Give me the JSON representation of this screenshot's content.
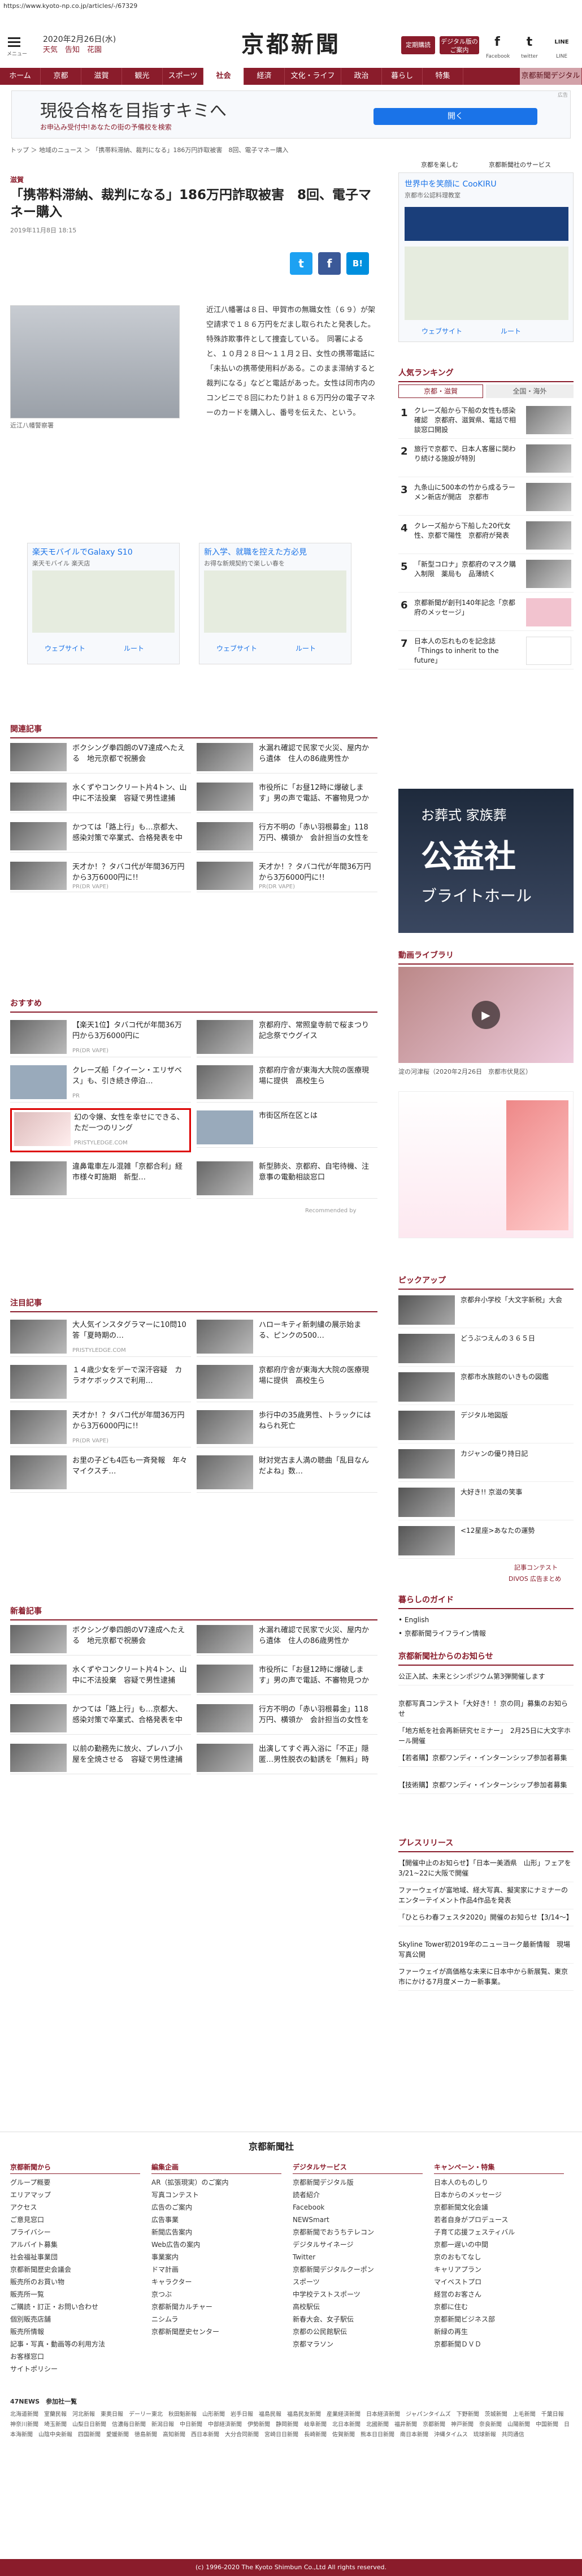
{
  "url": "https://www.kyoto-np.co.jp/articles/-/67329",
  "header": {
    "menu_label": "メニュー",
    "date": "2020年2月26日(水)",
    "weather": "天気　告知　花園",
    "logo": "京都新聞",
    "btn_signup": "定期購読",
    "btn_digital": "デジタル版のご案内",
    "social": [
      {
        "icon": "f",
        "label": "Facebook"
      },
      {
        "icon": "t",
        "label": "twitter"
      },
      {
        "icon": "LINE",
        "label": "LINE"
      }
    ]
  },
  "nav": [
    "ホーム",
    "京都",
    "滋賀",
    "観光",
    "スポーツ",
    "社会",
    "経済",
    "文化・ライフ",
    "政治",
    "暮らし",
    "特集",
    "京都新聞デジタル"
  ],
  "nav_active": 5,
  "ad_top": {
    "title": "現役合格を目指すキミへ",
    "sub": "お申込み受付中!あなたの街の予備校を検索",
    "btn": "開く",
    "label": "広告"
  },
  "breadcrumb": "トップ ＞ 地域のニュース ＞ 「携帯料滞納、裁判になる」186万円詐取被害　8回、電子マネー購入",
  "right_links": [
    "京都を楽しむ",
    "京都新聞社のサービス"
  ],
  "article": {
    "category": "滋賀",
    "title": "「携帯料滞納、裁判になる」186万円詐取被害　8回、電子マネー購入",
    "date": "2019年11月8日 18:15",
    "caption": "近江八幡警察署",
    "body": "近江八幡署は８日、甲賀市の無職女性（６９）が架空請求で１８６万円をだまし取られたと発表した。特殊詐欺事件として捜査している。　同署によると、１０月２８日～１１月２日、女性の携帯電話に「未払いの携帯使用料がある。このまま滞納すると裁判になる」などと電話があった。女性は同市内のコンビニで８回にわたり計１８６万円分の電子マネーのカードを購入し、番号を伝えた、という。",
    "share": [
      "t",
      "f",
      "B!"
    ]
  },
  "ad_mid": [
    {
      "title": "楽天モバイルでGalaxy S10",
      "sub": "楽天モバイル 楽天店",
      "btn_web": "ウェブサイト",
      "btn_route": "ルート"
    },
    {
      "title": "新入学、就職を控えた方必見",
      "sub": "お得な新規契約で楽しい春を",
      "btn_web": "ウェブサイト",
      "btn_route": "ルート"
    }
  ],
  "right_ad": {
    "title": "世界中を笑顔に CooKIRU",
    "sub": "京都市公認料理教室",
    "btn_web": "ウェブサイト",
    "btn_route": "ルート"
  },
  "ranking": {
    "title": "人気ランキング",
    "tabs": [
      "京都・滋賀",
      "全国・海外"
    ],
    "items": [
      {
        "n": "1",
        "text": "クレーズ船から下船の女性も感染確認　京都府、滋賀県、電話で相談窓口開設"
      },
      {
        "n": "2",
        "text": "旅行で京都で、日本人客層に関わり続ける施設が特別"
      },
      {
        "n": "3",
        "text": "九条山に500本の竹から成るラーメン新店が開店　京都市"
      },
      {
        "n": "4",
        "text": "クレーズ船から下船した20代女性、京都で陽性　京都府が発表"
      },
      {
        "n": "5",
        "text": "「新型コロナ」京都府のマスク購入制限　薬局も　品薄続く"
      },
      {
        "n": "6",
        "text": "京都新聞が創刊140年記念「京都府のメッセージ」"
      },
      {
        "n": "7",
        "text": "日本人の忘れものを記念誌　「Things to inherit to the future」"
      }
    ]
  },
  "related": {
    "title": "関連記事",
    "items": [
      {
        "text": "ボクシング拳四朗のV7達成へたえる　地元京都で祝勝会",
        "meta": ""
      },
      {
        "text": "水漏れ確認で民家で火災、屋内から遺体　住人の86歳男性か",
        "meta": ""
      },
      {
        "text": "水くずやコンクリート片4トン、山中に不法投棄　容疑で男性逮捕",
        "meta": ""
      },
      {
        "text": "市役所に「お昼12時に爆破します」男の声で電話、不審物見つからず",
        "meta": ""
      },
      {
        "text": "かつては「路上行」も…京都大、感染対策で卒業式、合格発表を中止に",
        "meta": ""
      },
      {
        "text": "行方不明の「赤い羽根募金」118万円、横領か　会計担当の女性を書類送検",
        "meta": ""
      },
      {
        "text": "天才か！？タバコ代が年間36万円から3万6000円に!!",
        "meta": "PR(DR VAPE)"
      },
      {
        "text": "天才か！？タバコ代が年間36万円から3万6000円に!!",
        "meta": "PR(DR VAPE)"
      }
    ]
  },
  "recommend": {
    "title": "おすすめ",
    "items": [
      {
        "text": "【楽天1位】タバコ代が年間36万円から3万6000円に",
        "meta": "PR(DR VAPE)"
      },
      {
        "text": "京都府庁、常照皇寺前で桜まつり　記念祭でウグイス",
        "meta": ""
      },
      {
        "text": "クレーズ船「クイーン・エリザベス」も、引き続き停泊…",
        "meta": "PR"
      },
      {
        "text": "京都府庁舎が東海大大院の医療現場に提供　高校生ら",
        "meta": ""
      },
      {
        "text": "幻の令嬢、女性を幸せにできる、ただ一つのリング",
        "meta": "PRISTYLEDGE.COM"
      },
      {
        "text": "市街区所在区とは",
        "meta": ""
      },
      {
        "text": "違鼻電車左ル混雑「京都合利」経市様々町施期　新型…",
        "meta": ""
      },
      {
        "text": "新型肺炎、京都府、自宅待機、注意事の電動相談窓口",
        "meta": ""
      }
    ]
  },
  "attention": {
    "title": "注目記事",
    "items": [
      {
        "text": "大人気インスタグラマーに10問10答「夏時期の…",
        "meta": "PRISTYLEDGE.COM"
      },
      {
        "text": "ハローキティ新刺繍の展示始まる、ピンクの500…",
        "meta": ""
      },
      {
        "text": "１４歳少女をデーで深汗容疑　カラオケボックスで利用…",
        "meta": ""
      },
      {
        "text": "京都府庁舎が東海大大院の医療現場に提供　高校生ら",
        "meta": ""
      },
      {
        "text": "天才か！？タバコ代が年間36万円から3万6000円に!!",
        "meta": "PR(DR VAPE)"
      },
      {
        "text": "歩行中の35歳男性、トラックにはねられ死亡",
        "meta": ""
      },
      {
        "text": "お里の子ども4匹も一斉発報　年々マイクスチ…",
        "meta": ""
      },
      {
        "text": "財対党古ま人満の聴曲「乱目なんだよね」数…",
        "meta": ""
      }
    ]
  },
  "latest": {
    "title": "新着記事",
    "items": [
      {
        "text": "ボクシング拳四朗のV7達成へたえる　地元京都で祝勝会",
        "meta": ""
      },
      {
        "text": "水漏れ確認で民家で火災、屋内から遺体　住人の86歳男性か",
        "meta": ""
      },
      {
        "text": "水くずやコンクリート片4トン、山中に不法投棄　容疑で男性逮捕",
        "meta": ""
      },
      {
        "text": "市役所に「お昼12時に爆破します」男の声で電話、不審物見つからず",
        "meta": ""
      },
      {
        "text": "かつては「路上行」も…京都大、感染対策で卒業式、合格発表を中止に",
        "meta": ""
      },
      {
        "text": "行方不明の「赤い羽根募金」118万円、横領か　会計担当の女性を書類送検",
        "meta": ""
      },
      {
        "text": "以前の勤務先に放火、プレハブ小屋を全焼させる　容疑で男性逮捕",
        "meta": ""
      },
      {
        "text": "出演してすぐ再入浴に「不正」隠匿…男性脱衣の勧誘を「無料」時間地域へ",
        "meta": ""
      }
    ]
  },
  "recommended_label": "Recommended by",
  "video": {
    "title": "動画ライブラリ",
    "caption": "淀の河津桜（2020年2月26日　京都市伏見区）"
  },
  "pickup": {
    "title": "ピックアップ",
    "items": [
      "京都弁小学校「大文字新税」大会",
      "どうぶつえんの３６５日",
      "京都市水族館のいきもの図鑑",
      "デジタル地図版",
      "カジャンの優り持日記",
      "大好き!! 京滋の笑事",
      "<12星座>あなたの運勢"
    ],
    "more": "記事コンテスト",
    "divo": "DIVOS 広告まとめ"
  },
  "guide": {
    "title": "暮らしのガイド",
    "items": [
      "English",
      "京都新聞ライフライン情報"
    ]
  },
  "notice": {
    "title": "京都新聞社からのお知らせ",
    "items": [
      "公正入試、未来とシンポジウム第3弾開催します",
      "京都写真コンテスト「大好き！！京の同」募集のお知らせ",
      "「地方紙を社会再新研究セミナー」　2月25日に大文字ホール開催",
      "【若者購】京都ワンディ・インターンシップ参加者募集",
      "【技術購】京都ワンディ・インターンシップ参加者募集"
    ]
  },
  "press": {
    "title": "プレスリリース",
    "items": [
      "【開催中止のお知らせ】「日本一美酒県　山形」フェアを3/21~22に大阪で開催",
      "ファーウェイが富地域、経大写真、擬実家にナミナーのエンターテイメント作品4作品を発表",
      "「ひとらわ春フェスタ2020」開催のお知らせ【3/14～】",
      "Skyline Tower初2019年のニューヨーク最新情報　現場写真公開",
      "ファーウェイが高価格な未来に日本中から新展覧、東京市にかける7月度メーカー新事業。"
    ]
  },
  "footer": {
    "logo": "京都新聞社",
    "cols": [
      {
        "head": "京都新聞から",
        "items": [
          "グループ概要",
          "エリアマップ",
          "アクセス",
          "ご意見窓口",
          "プライバシー",
          "アルバイト募集",
          "社会福祉事業団",
          "京都新聞歴史会議会",
          "販売所のお買い物",
          "販売所一覧",
          "ご購読・訂正・お問い合わせ",
          "個別販売店舗",
          "販売所情報",
          "記事・写真・動画等の利用方法",
          "お客様窓口",
          "サイトポリシー"
        ]
      },
      {
        "head": "編集企画",
        "items": [
          "AR（拡張現実）のご案内",
          "写真コンテスト",
          "広告のご案内",
          "広告事業",
          "新聞広告案内",
          "Web広告の案内",
          "事業案内",
          "ドマ計画",
          "キャラクター",
          "京つぶ",
          "京都新聞カルチャー",
          "ニシムラ",
          "京都新聞歴史センター"
        ]
      },
      {
        "head": "デジタルサービス",
        "items": [
          "京都新聞デジタル版",
          "読者紹介",
          "Facebook",
          "NEWSmart",
          "京都新聞でおうちテレコン",
          "デジタルサイネージ",
          "Twitter",
          "京都新聞デジタルクーポン",
          "スポーツ",
          "中学校テストスポーツ",
          "高校駅伝",
          "新春大会、女子駅伝",
          "京都の公民館駅伝",
          "京都マラソン"
        ]
      },
      {
        "head": "キャンペーン・特集",
        "items": [
          "日本人のものしり",
          "日本からのメッセージ",
          "京都新聞文化会議",
          "若者自身がプロデュース",
          "子育て応援フェスティバル",
          "京都一遅いの中間",
          "京のおもてなし",
          "キャリアプラン",
          "マイベストプロ",
          "経営のお客さん",
          "京都に住む",
          "京都新聞ビジネス部",
          "新緑の再生",
          "京都新聞ＤＶＤ"
        ]
      }
    ],
    "network_label": "47NEWS　参加社一覧",
    "network": "北海道新聞　室蘭民報　河北新報　東奥日報　デーリー東北　秋田魁新報　山形新聞　岩手日報　福島民報　福島民友新聞　産業経済新聞　日本経済新聞　ジャパンタイムズ　下野新聞　茨城新聞　上毛新聞　千葉日報　神奈川新聞　埼玉新聞　山梨日日新聞　信濃毎日新聞　新潟日報　中日新聞　中部経済新聞　伊勢新聞　静岡新聞　岐阜新聞　北日本新聞　北國新聞　福井新聞　京都新聞　神戸新聞　奈良新聞　山陽新聞　中国新聞　日本海新聞　山陰中央新報　四国新聞　愛媛新聞　徳島新聞　高知新聞　西日本新聞　大分合同新聞　宮崎日日新聞　長崎新聞　佐賀新聞　熊本日日新聞　南日本新聞　沖縄タイムス　琉球新報　共同通信",
    "copyright": "(c) 1996-2020 The Kyoto Shimbun Co.,Ltd All rights reserved."
  },
  "colors": {
    "brand": "#8a1c2b",
    "nav": "#8a1c2b"
  }
}
